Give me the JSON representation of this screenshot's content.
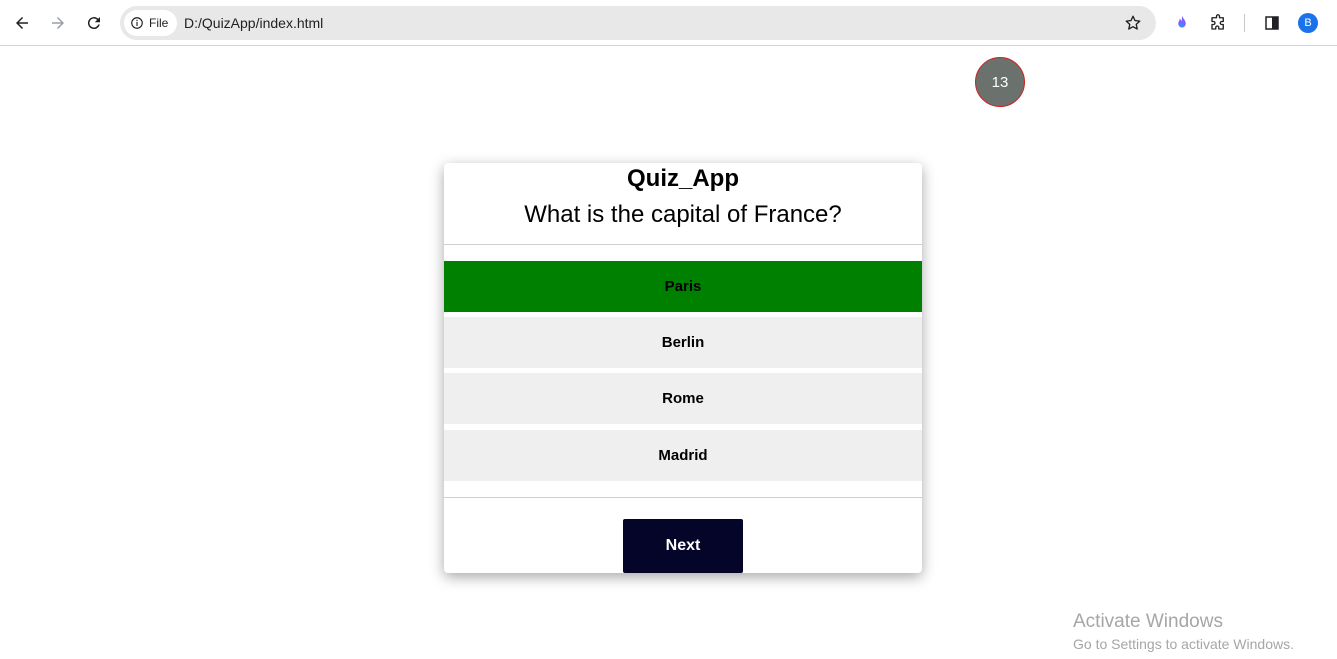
{
  "browser": {
    "chip_label": "File",
    "url": "D:/QuizApp/index.html",
    "profile_initial": "B"
  },
  "quiz": {
    "timer": "13",
    "app_title": "Quiz_App",
    "question": "What is the capital of France?",
    "options": [
      "Paris",
      "Berlin",
      "Rome",
      "Madrid"
    ],
    "selected_option": "Paris",
    "next_label": "Next"
  },
  "colors": {
    "selected": "#008000",
    "option_bg": "#efefef",
    "next_bg": "#05052a",
    "timer_bg": "#6b716d"
  },
  "watermark": {
    "title": "Activate Windows",
    "subtitle": "Go to Settings to activate Windows."
  }
}
